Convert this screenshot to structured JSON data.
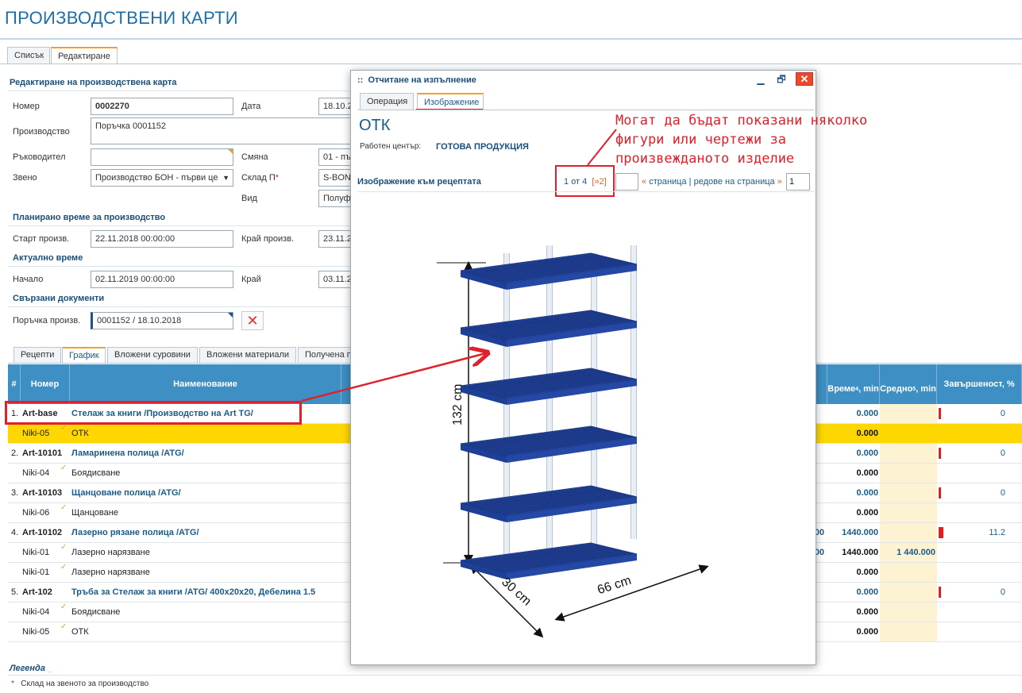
{
  "page": {
    "title": "ПРОИЗВОДСТВЕНИ КАРТИ"
  },
  "main_tabs": [
    {
      "label": "Списък"
    },
    {
      "label": "Редактиране"
    }
  ],
  "form": {
    "section_title": "Редактиране на производствена карта",
    "number_label": "Номер",
    "number_value": "0002270",
    "date_label": "Дата",
    "date_value": "18.10.2",
    "production_label": "Производство",
    "production_value": "Поръчка 0001152",
    "manager_label": "Ръководител",
    "manager_value": "",
    "shift_label": "Смяна",
    "shift_value": "01 - пъ",
    "unit_label": "Звено",
    "unit_value": "Производство БОН - първи це",
    "warehouse_label": "Склад П",
    "warehouse_required": "*",
    "warehouse_value": "S-BON-",
    "type_label": "Вид",
    "type_value": "Полуф",
    "planned_title": "Планирано време за производство",
    "start_label": "Старт произв.",
    "start_value": "22.11.2018 00:00:00",
    "end_label": "Край произв.",
    "end_value": "23.11.2",
    "actual_title": "Актуално време",
    "actual_start_label": "Начало",
    "actual_start_value": "02.11.2019 00:00:00",
    "actual_end_label": "Край",
    "actual_end_value": "03.11.2",
    "linked_title": "Свързани документи",
    "order_label": "Поръчка произв.",
    "order_value": "0001152 / 18.10.2018",
    "clear_symbol": "✕"
  },
  "sub_tabs": [
    {
      "label": "Рецепти"
    },
    {
      "label": "График"
    },
    {
      "label": "Вложени суровини"
    },
    {
      "label": "Вложени материали"
    },
    {
      "label": "Получена п"
    }
  ],
  "grid": {
    "headers": {
      "hash": "#",
      "number": "Номер",
      "name": "Наименование",
      "time": "Време",
      "time_sup": "4",
      "time_unit": ", min",
      "avg": "Средно",
      "avg_sup": "5",
      "avg_unit": ", min",
      "completion": "Завършеност, %"
    },
    "rows": [
      {
        "idx": "1.",
        "code": "Art-base",
        "name": "Стелаж за книги /Производство на Art TG/",
        "partial": "",
        "time": "0.000",
        "avg": "",
        "pct": "0",
        "group": true,
        "bar": true
      },
      {
        "idx": "",
        "code": "Niki-05",
        "name": "ОТК",
        "partial": "",
        "time": "0.000",
        "avg": "",
        "pct": "",
        "group": false,
        "bar": false
      },
      {
        "idx": "2.",
        "code": "Art-10101",
        "name": "Ламаринена полица /ATG/",
        "partial": "",
        "time": "0.000",
        "avg": "",
        "pct": "0",
        "group": true,
        "bar": true
      },
      {
        "idx": "",
        "code": "Niki-04",
        "name": "Боядисване",
        "partial": "",
        "time": "0.000",
        "avg": "",
        "pct": "",
        "group": false,
        "bar": false
      },
      {
        "idx": "3.",
        "code": "Art-10103",
        "name": "Щанцоване полица /ATG/",
        "partial": "",
        "time": "0.000",
        "avg": "",
        "pct": "0",
        "group": true,
        "bar": true
      },
      {
        "idx": "",
        "code": "Niki-06",
        "name": "Щанцоване",
        "partial": "",
        "time": "0.000",
        "avg": "",
        "pct": "",
        "group": false,
        "bar": false
      },
      {
        "idx": "4.",
        "code": "Art-10102",
        "name": "Лазерно рязане полица /ATG/",
        "partial": "00",
        "time": "1440.000",
        "avg": "",
        "pct": "11.2",
        "group": true,
        "bar": true
      },
      {
        "idx": "",
        "code": "Niki-01",
        "name": "Лазерно нарязване",
        "partial": "00",
        "time": "1440.000",
        "avg": "1 440.000",
        "pct": "",
        "group": false,
        "bar": false
      },
      {
        "idx": "",
        "code": "Niki-01",
        "name": "Лазерно нарязване",
        "partial": "",
        "time": "0.000",
        "avg": "",
        "pct": "",
        "group": false,
        "bar": false
      },
      {
        "idx": "5.",
        "code": "Art-102",
        "name": "Тръба за Стелаж за книги /ATG/ 400x20x20, Дебелина 1.5",
        "partial": "",
        "time": "0.000",
        "avg": "",
        "pct": "0",
        "group": true,
        "bar": true
      },
      {
        "idx": "",
        "code": "Niki-04",
        "name": "Боядисване",
        "partial": "",
        "time": "0.000",
        "avg": "",
        "pct": "",
        "group": false,
        "bar": false
      },
      {
        "idx": "",
        "code": "Niki-05",
        "name": "ОТК",
        "partial": "",
        "time": "0.000",
        "avg": "",
        "pct": "",
        "group": false,
        "bar": false
      }
    ]
  },
  "legend": {
    "title": "Легенда",
    "marker": "*",
    "text": "Склад на звеното за производство"
  },
  "dialog": {
    "title": "Отчитане на изпълнение",
    "title_prefix": "::",
    "minimize": "▁",
    "maximize": "🗗",
    "close": "✕",
    "tabs": [
      {
        "label": "Операция"
      },
      {
        "label": "Изображение"
      }
    ],
    "heading": "ОТК",
    "work_center_label": "Работен център:",
    "work_center_value": "ГОТОВА ПРОДУКЦИЯ",
    "image_section": "Изображение към рецептата",
    "pager_count": "1 от 4",
    "pager_next": "[»2]",
    "pager_page_field": "",
    "pager_prev_arrow": "«",
    "pager_page_text": "страница",
    "pager_sep": "|",
    "pager_rows_text": "редове на страница",
    "pager_rows_arrow": "»",
    "pager_rows_value": "1",
    "dimensions": {
      "height": "132 cm",
      "depth": "30 cm",
      "width": "66 cm"
    },
    "shelf_color": "#2a4fb0",
    "post_color": "#e8eef5"
  },
  "annotation": {
    "lines": [
      "Могат да бъдат показани няколко",
      "фигури или чертежи за",
      "произвежданото изделие"
    ],
    "color": "#e0202a"
  }
}
